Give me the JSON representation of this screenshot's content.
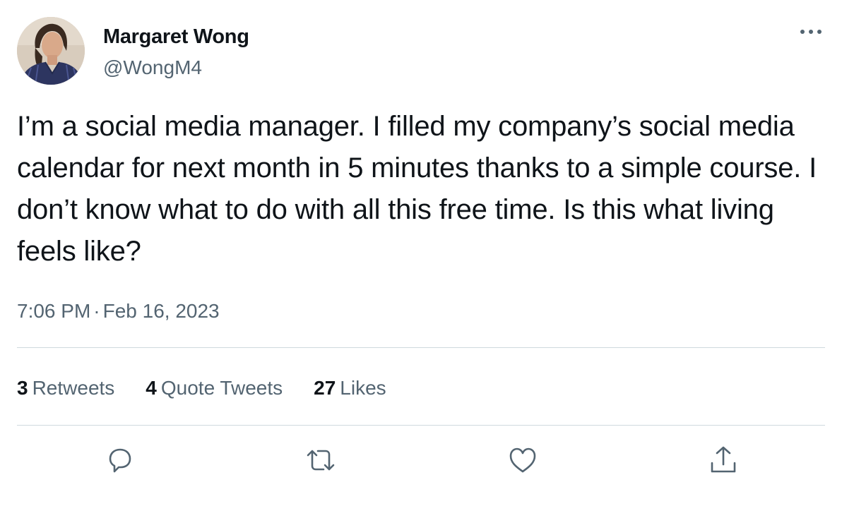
{
  "author": {
    "display_name": "Margaret Wong",
    "handle": "@WongM4"
  },
  "tweet": {
    "text": "I’m a social media manager. I filled my company’s social media calendar for next month in 5 minutes thanks to a simple course. I don’t know what to do with all this free time. Is this what living feels like?",
    "time": "7:06 PM",
    "separator": "·",
    "date": "Feb 16, 2023"
  },
  "stats": {
    "retweets": {
      "count": "3",
      "label": "Retweets"
    },
    "quote_tweets": {
      "count": "4",
      "label": "Quote Tweets"
    },
    "likes": {
      "count": "27",
      "label": "Likes"
    }
  },
  "icons": {
    "more": "more-dots-icon",
    "reply": "reply-bubble-icon",
    "retweet": "retweet-arrows-icon",
    "like": "heart-icon",
    "share": "share-upload-icon"
  },
  "colors": {
    "text_primary": "#0f1419",
    "text_secondary": "#536471",
    "divider": "#cfd9de"
  }
}
